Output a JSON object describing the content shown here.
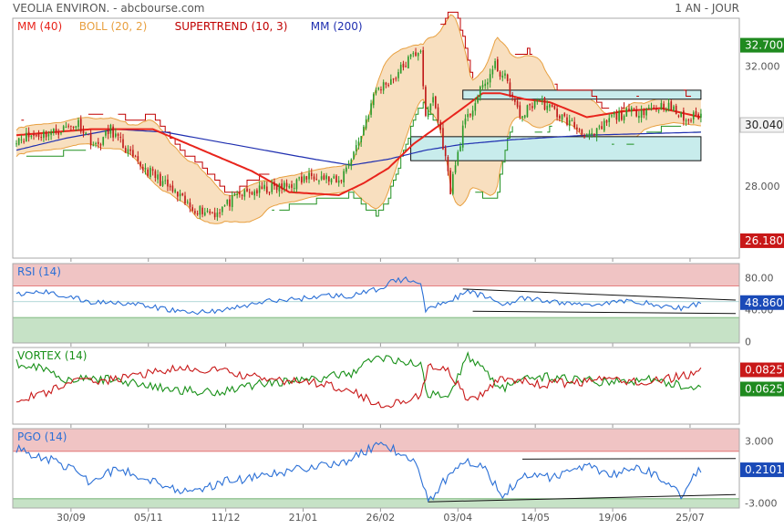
{
  "header": {
    "title": "VEOLIA ENVIRON. - abcbourse.com",
    "period": "1 AN - JOUR"
  },
  "colors": {
    "ma40": "#e8241c",
    "boll": "#e8a040",
    "boll_fill": "#f7d9b4",
    "supertrend": "#c00000",
    "supertrend_up": "#209020",
    "ma200": "#1f2fb0",
    "rsi": "#2a6fd6",
    "vortex_plus": "#189018",
    "vortex_minus": "#c81818",
    "pgo": "#2a6fd6",
    "zone_high": "#f0c4c4",
    "zone_low": "#c6e2c6",
    "box_fill": "#c8ecec",
    "badge_green": "#1f8a1f",
    "badge_red": "#c81818",
    "badge_blue": "#1a4ab8",
    "badge_grey": "#f2f2f2"
  },
  "chart_data": [
    {
      "panel": "price",
      "type": "candlestick",
      "legend": [
        {
          "label": "MM (40)",
          "color": "#e8241c"
        },
        {
          "label": "BOLL (20, 2)",
          "color": "#e8a040"
        },
        {
          "label": "SUPERTREND (10, 3)",
          "color": "#c00000"
        },
        {
          "label": "MM (200)",
          "color": "#1f2fb0"
        }
      ],
      "ylim": [
        25.6,
        33.6
      ],
      "yticks": [
        "32.000",
        "28.000"
      ],
      "badges": [
        {
          "text": "32.700",
          "value": 32.7,
          "color": "#1f8a1f"
        },
        {
          "text": "30.040",
          "value": 30.04,
          "color": "#f2f2f2"
        },
        {
          "text": "26.180",
          "value": 26.18,
          "color": "#c81818"
        }
      ],
      "x_dates": [
        "30/09",
        "05/11",
        "11/12",
        "21/01",
        "26/02",
        "03/04",
        "14/05",
        "19/06",
        "25/07"
      ],
      "close_anchors": [
        [
          0,
          29.6
        ],
        [
          15,
          29.8
        ],
        [
          25,
          30.1
        ],
        [
          32,
          29.3
        ],
        [
          38,
          29.9
        ],
        [
          48,
          28.8
        ],
        [
          55,
          28.4
        ],
        [
          62,
          27.9
        ],
        [
          70,
          27.3
        ],
        [
          80,
          27.1
        ],
        [
          90,
          27.7
        ],
        [
          100,
          27.9
        ],
        [
          110,
          28.0
        ],
        [
          120,
          28.4
        ],
        [
          130,
          28.1
        ],
        [
          138,
          29.5
        ],
        [
          145,
          31.2
        ],
        [
          152,
          31.6
        ],
        [
          158,
          32.2
        ],
        [
          163,
          32.6
        ],
        [
          165,
          30.2
        ],
        [
          168,
          31.0
        ],
        [
          172,
          29.4
        ],
        [
          175,
          27.9
        ],
        [
          180,
          29.9
        ],
        [
          186,
          31.0
        ],
        [
          193,
          32.0
        ],
        [
          197,
          31.6
        ],
        [
          203,
          30.3
        ],
        [
          210,
          30.9
        ],
        [
          220,
          30.3
        ],
        [
          232,
          29.6
        ],
        [
          240,
          30.3
        ],
        [
          250,
          30.5
        ],
        [
          262,
          30.7
        ],
        [
          270,
          30.2
        ],
        [
          276,
          30.4
        ]
      ],
      "ma40_anchors": [
        [
          0,
          29.7
        ],
        [
          30,
          29.9
        ],
        [
          55,
          29.9
        ],
        [
          75,
          29.2
        ],
        [
          95,
          28.5
        ],
        [
          110,
          27.8
        ],
        [
          130,
          27.7
        ],
        [
          140,
          28.1
        ],
        [
          150,
          28.6
        ],
        [
          160,
          29.4
        ],
        [
          170,
          30.0
        ],
        [
          180,
          30.6
        ],
        [
          188,
          31.1
        ],
        [
          195,
          31.1
        ],
        [
          205,
          30.9
        ],
        [
          215,
          30.8
        ],
        [
          230,
          30.3
        ],
        [
          245,
          30.5
        ],
        [
          260,
          30.6
        ],
        [
          276,
          30.3
        ]
      ],
      "ma200_anchors": [
        [
          0,
          29.2
        ],
        [
          20,
          29.6
        ],
        [
          40,
          29.9
        ],
        [
          60,
          29.8
        ],
        [
          80,
          29.5
        ],
        [
          100,
          29.2
        ],
        [
          120,
          28.9
        ],
        [
          135,
          28.7
        ],
        [
          150,
          28.9
        ],
        [
          165,
          29.2
        ],
        [
          180,
          29.4
        ],
        [
          200,
          29.55
        ],
        [
          230,
          29.7
        ],
        [
          276,
          29.8
        ]
      ],
      "support_box": {
        "start": 159,
        "end": 276,
        "top": 29.65,
        "bottom": 28.85
      },
      "resistance_box": {
        "start": 180,
        "end": 276,
        "top": 31.2,
        "bottom": 30.9
      }
    },
    {
      "panel": "rsi",
      "type": "line",
      "legend": [
        {
          "label": "RSI (14)",
          "color": "#2a6fd6"
        }
      ],
      "ylim": [
        -2,
        98
      ],
      "yticks": [
        "80.00",
        "40.00",
        "0"
      ],
      "zone_high": 70,
      "zone_low": 30,
      "badge": {
        "text": "48.860",
        "value": 48.86,
        "color": "#1a4ab8"
      },
      "anchors": [
        [
          0,
          58
        ],
        [
          10,
          63
        ],
        [
          20,
          57
        ],
        [
          30,
          49
        ],
        [
          40,
          50
        ],
        [
          55,
          43
        ],
        [
          70,
          36
        ],
        [
          85,
          40
        ],
        [
          100,
          50
        ],
        [
          115,
          54
        ],
        [
          125,
          58
        ],
        [
          135,
          57
        ],
        [
          145,
          65
        ],
        [
          152,
          76
        ],
        [
          158,
          78
        ],
        [
          163,
          75
        ],
        [
          165,
          37
        ],
        [
          170,
          48
        ],
        [
          175,
          52
        ],
        [
          182,
          62
        ],
        [
          188,
          58
        ],
        [
          196,
          47
        ],
        [
          205,
          54
        ],
        [
          215,
          50
        ],
        [
          230,
          46
        ],
        [
          240,
          49
        ],
        [
          250,
          51
        ],
        [
          260,
          44
        ],
        [
          268,
          42
        ],
        [
          276,
          48
        ]
      ],
      "trendlines": [
        [
          [
            180,
            66
          ],
          [
            290,
            52
          ]
        ],
        [
          [
            184,
            38
          ],
          [
            290,
            35
          ]
        ]
      ]
    },
    {
      "panel": "vortex",
      "type": "line",
      "legend": [
        {
          "label": "VORTEX (14)",
          "color": "#189018"
        }
      ],
      "ylim": [
        0.3,
        1.5
      ],
      "badges": [
        {
          "text": "0.0825",
          "value": 1.15,
          "color": "#c81818"
        },
        {
          "text": "0.0625",
          "value": 0.85,
          "color": "#1f8a1f"
        }
      ],
      "series": [
        {
          "color": "#189018",
          "anchors": [
            [
              0,
              1.25
            ],
            [
              10,
              1.2
            ],
            [
              20,
              1.0
            ],
            [
              40,
              1.0
            ],
            [
              60,
              0.85
            ],
            [
              80,
              0.8
            ],
            [
              100,
              0.95
            ],
            [
              120,
              1.0
            ],
            [
              135,
              1.1
            ],
            [
              145,
              1.35
            ],
            [
              155,
              1.3
            ],
            [
              163,
              1.2
            ],
            [
              166,
              0.75
            ],
            [
              175,
              0.8
            ],
            [
              182,
              1.35
            ],
            [
              188,
              1.2
            ],
            [
              195,
              0.85
            ],
            [
              210,
              1.05
            ],
            [
              225,
              1.0
            ],
            [
              240,
              0.95
            ],
            [
              255,
              1.0
            ],
            [
              268,
              0.9
            ],
            [
              276,
              0.88
            ]
          ]
        },
        {
          "color": "#c81818",
          "anchors": [
            [
              0,
              0.7
            ],
            [
              10,
              0.75
            ],
            [
              20,
              0.95
            ],
            [
              40,
              1.0
            ],
            [
              60,
              1.15
            ],
            [
              80,
              1.15
            ],
            [
              100,
              1.0
            ],
            [
              120,
              0.95
            ],
            [
              135,
              0.85
            ],
            [
              145,
              0.6
            ],
            [
              155,
              0.65
            ],
            [
              163,
              0.75
            ],
            [
              166,
              1.2
            ],
            [
              175,
              1.1
            ],
            [
              182,
              0.65
            ],
            [
              188,
              0.75
            ],
            [
              195,
              1.05
            ],
            [
              210,
              0.92
            ],
            [
              225,
              0.95
            ],
            [
              240,
              1.0
            ],
            [
              255,
              0.95
            ],
            [
              268,
              1.05
            ],
            [
              276,
              1.12
            ]
          ]
        }
      ]
    },
    {
      "panel": "pgo",
      "type": "line",
      "legend": [
        {
          "label": "PGO (14)",
          "color": "#2a6fd6"
        }
      ],
      "ylim": [
        -3.5,
        4.2
      ],
      "yticks": [
        "3.000",
        "-3.000"
      ],
      "zone_high": 2.0,
      "zone_low": -2.6,
      "badge": {
        "text": "0.2101",
        "value": 0.21,
        "color": "#1a4ab8"
      },
      "anchors": [
        [
          0,
          2.2
        ],
        [
          10,
          1.5
        ],
        [
          20,
          0.6
        ],
        [
          30,
          -1.0
        ],
        [
          40,
          0.3
        ],
        [
          55,
          -0.8
        ],
        [
          70,
          -2.1
        ],
        [
          85,
          -0.8
        ],
        [
          100,
          -0.5
        ],
        [
          115,
          0.4
        ],
        [
          125,
          0.7
        ],
        [
          135,
          1.2
        ],
        [
          145,
          2.6
        ],
        [
          152,
          2.2
        ],
        [
          160,
          1.0
        ],
        [
          164,
          -1.2
        ],
        [
          166,
          -2.9
        ],
        [
          172,
          -1.0
        ],
        [
          180,
          1.2
        ],
        [
          188,
          0.7
        ],
        [
          196,
          -2.4
        ],
        [
          205,
          -0.1
        ],
        [
          215,
          -0.6
        ],
        [
          230,
          0.6
        ],
        [
          240,
          -0.2
        ],
        [
          250,
          0.5
        ],
        [
          260,
          -0.6
        ],
        [
          268,
          -2.2
        ],
        [
          276,
          0.3
        ]
      ],
      "trendlines": [
        [
          [
            204,
            1.25
          ],
          [
            290,
            1.3
          ]
        ],
        [
          [
            166,
            -2.9
          ],
          [
            290,
            -2.2
          ]
        ]
      ]
    }
  ]
}
